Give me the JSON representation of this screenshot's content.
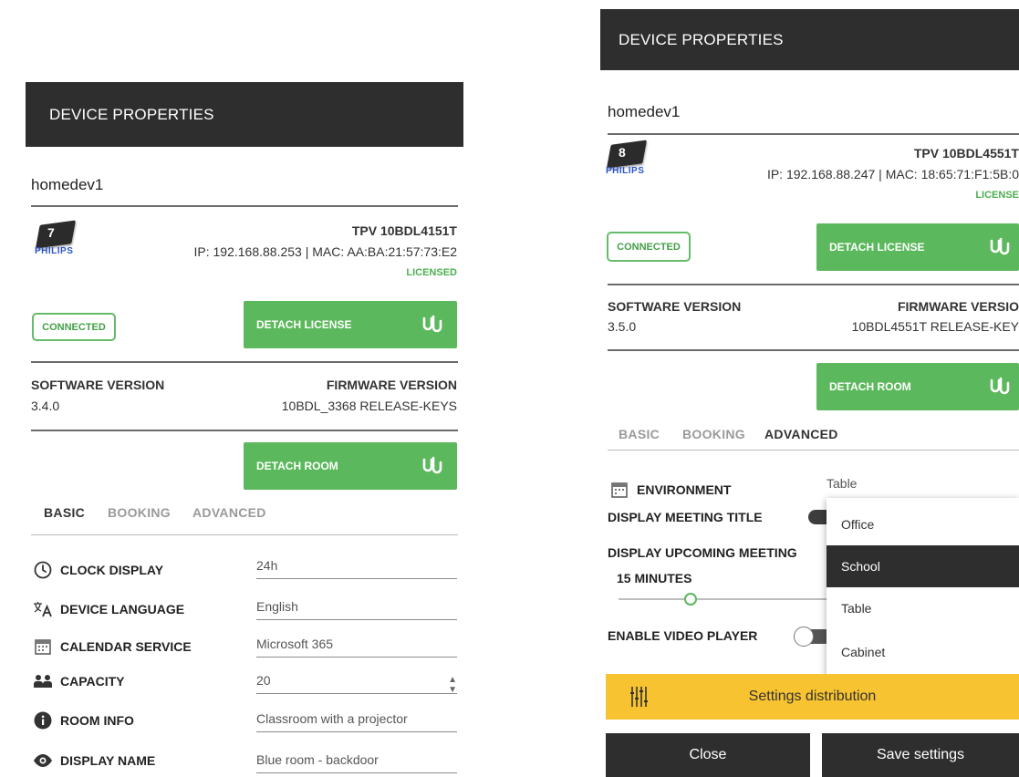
{
  "left": {
    "header_title": "DEVICE PROPERTIES",
    "device_name": "homedev1",
    "device_number": "7",
    "brand": "PHILIPS",
    "model": "TPV 10BDL4151T",
    "ip_mac": "IP: 192.168.88.253 | MAC: AA:BA:21:57:73:E2",
    "license_status": "LICENSED",
    "connection_status": "CONNECTED",
    "detach_license_label": "DETACH LICENSE",
    "software_version_label": "SOFTWARE VERSION",
    "software_version": "3.4.0",
    "firmware_version_label": "FIRMWARE VERSION",
    "firmware_version": "10BDL_3368 RELEASE-KEYS",
    "detach_room_label": "DETACH ROOM",
    "tabs": [
      "BASIC",
      "BOOKING",
      "ADVANCED"
    ],
    "active_tab": "BASIC",
    "settings": [
      {
        "label": "CLOCK DISPLAY",
        "icon": "clock-icon",
        "value": "24h"
      },
      {
        "label": "DEVICE LANGUAGE",
        "icon": "translate-icon",
        "value": "English"
      },
      {
        "label": "CALENDAR SERVICE",
        "icon": "calendar-icon",
        "value": "Microsoft 365"
      },
      {
        "label": "CAPACITY",
        "icon": "people-icon",
        "value": "20"
      },
      {
        "label": "ROOM INFO",
        "icon": "info-icon",
        "value": "Classroom with a projector"
      },
      {
        "label": "DISPLAY NAME",
        "icon": "eye-icon",
        "value": "Blue room - backdoor"
      }
    ]
  },
  "right": {
    "header_title": "DEVICE PROPERTIES",
    "device_name": "homedev1",
    "device_number": "8",
    "brand": "PHILIPS",
    "model": "TPV 10BDL4551T",
    "ip_mac": "IP: 192.168.88.247 | MAC: 18:65:71:F1:5B:0",
    "license_status": "LICENSE",
    "connection_status": "CONNECTED",
    "detach_license_label": "DETACH LICENSE",
    "software_version_label": "SOFTWARE VERSION",
    "software_version": "3.5.0",
    "firmware_version_label": "FIRMWARE VERSIO",
    "firmware_version": "10BDL4551T RELEASE-KEY",
    "detach_room_label": "DETACH ROOM",
    "tabs": [
      "BASIC",
      "BOOKING",
      "ADVANCED"
    ],
    "active_tab": "ADVANCED",
    "environment_label": "ENVIRONMENT",
    "environment_value": "Table",
    "display_meeting_title_label": "DISPLAY MEETING TITLE",
    "display_upcoming_meeting_label": "DISPLAY UPCOMING MEETING",
    "upcoming_minutes": "15 MINUTES",
    "enable_video_player_label": "ENABLE VIDEO PLAYER",
    "dropdown_options": [
      "Office",
      "School",
      "Table",
      "Cabinet"
    ],
    "dropdown_highlighted": "School",
    "settings_distribution_label": "Settings distribution",
    "close_label": "Close",
    "save_label": "Save settings"
  }
}
